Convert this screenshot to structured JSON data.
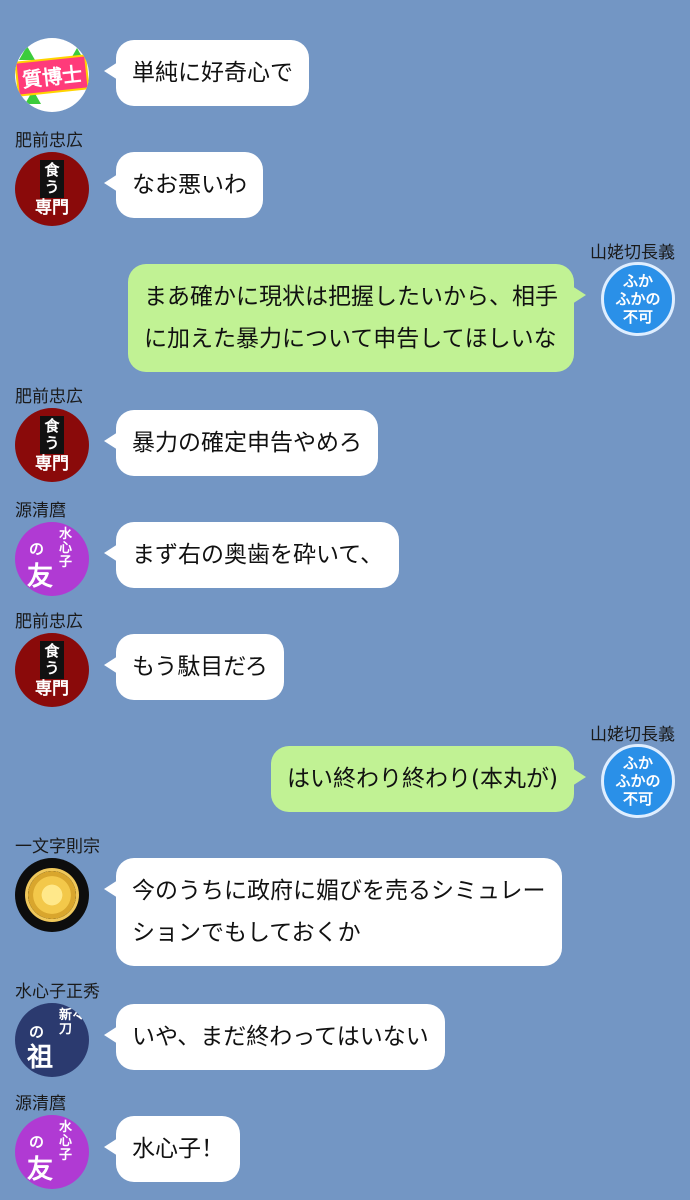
{
  "messages": [
    {
      "sender": "",
      "side": "left",
      "avatar": "hakase-icon",
      "avatar_text": "質博士",
      "lines": [
        "単純に好奇心で"
      ]
    },
    {
      "sender": "肥前忠広",
      "side": "left",
      "avatar": "shoku-senmon-icon",
      "avatar_top": "食う",
      "avatar_bottom": "専門",
      "lines": [
        "なお悪いわ"
      ]
    },
    {
      "sender": "山姥切長義",
      "side": "right",
      "avatar": "fuka-icon",
      "avatar_lines": [
        "ふか",
        "ふかの",
        "不可"
      ],
      "lines": [
        "まあ確かに現状は把握したいから、相手",
        "に加えた暴力について申告してほしいな"
      ]
    },
    {
      "sender": "肥前忠広",
      "side": "left",
      "avatar": "shoku-senmon-icon",
      "avatar_top": "食う",
      "avatar_bottom": "専門",
      "lines": [
        "暴力の確定申告やめろ"
      ]
    },
    {
      "sender": "源清麿",
      "side": "left",
      "avatar": "suishinshi-tomo-icon",
      "avatar_a": "の",
      "avatar_b": "友",
      "avatar_c": "水心子",
      "lines": [
        "まず右の奥歯を砕いて、"
      ]
    },
    {
      "sender": "肥前忠広",
      "side": "left",
      "avatar": "shoku-senmon-icon",
      "avatar_top": "食う",
      "avatar_bottom": "専門",
      "lines": [
        "もう駄目だろ"
      ]
    },
    {
      "sender": "山姥切長義",
      "side": "right",
      "avatar": "fuka-icon",
      "avatar_lines": [
        "ふか",
        "ふかの",
        "不可"
      ],
      "lines": [
        "はい終わり終わり(本丸が)"
      ]
    },
    {
      "sender": "一文字則宗",
      "side": "left",
      "avatar": "chrysanthemum-icon",
      "lines": [
        "今のうちに政府に媚びを売るシミュレー",
        "ションでもしておくか"
      ]
    },
    {
      "sender": "水心子正秀",
      "side": "left",
      "avatar": "shintou-so-icon",
      "avatar_a": "の",
      "avatar_b": "祖",
      "avatar_c": "新々刀",
      "lines": [
        "いや、まだ終わってはいない"
      ]
    },
    {
      "sender": "源清麿",
      "side": "left",
      "avatar": "suishinshi-tomo-icon",
      "avatar_a": "の",
      "avatar_b": "友",
      "avatar_c": "水心子",
      "lines": [
        "水心子！"
      ]
    }
  ],
  "colors": {
    "background": "#7396c4",
    "bubble_left": "#ffffff",
    "bubble_right": "#c1f294"
  }
}
